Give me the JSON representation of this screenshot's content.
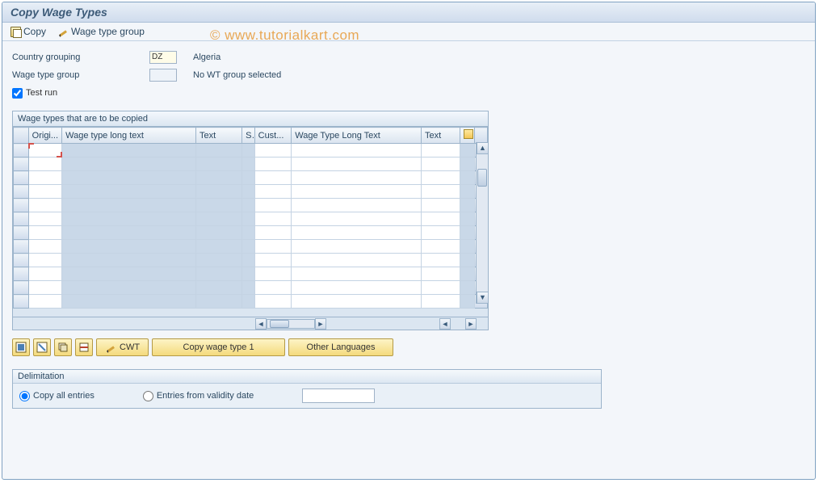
{
  "title": "Copy Wage Types",
  "toolbar": {
    "copy_label": "Copy",
    "wtg_label": "Wage type group"
  },
  "watermark": "© www.tutorialkart.com",
  "form": {
    "country_grouping_label": "Country grouping",
    "country_grouping_value": "DZ",
    "country_name": "Algeria",
    "wage_type_group_label": "Wage type group",
    "wage_type_group_value": "",
    "wtg_status": "No WT group selected",
    "test_run_label": "Test run",
    "test_run_checked": true
  },
  "grid": {
    "panel_title": "Wage types that are to be copied",
    "columns": [
      "Origi...",
      "Wage type long text",
      "Text",
      "S",
      "Cust...",
      "Wage Type Long Text",
      "Text"
    ],
    "row_count": 12
  },
  "buttons": {
    "cwt_label": "CWT",
    "copy1_label": "Copy wage type 1",
    "other_lang_label": "Other Languages"
  },
  "delimitation": {
    "panel_title": "Delimitation",
    "option_all": "Copy all entries",
    "option_from": "Entries from validity date",
    "selected": "all",
    "date_value": ""
  }
}
